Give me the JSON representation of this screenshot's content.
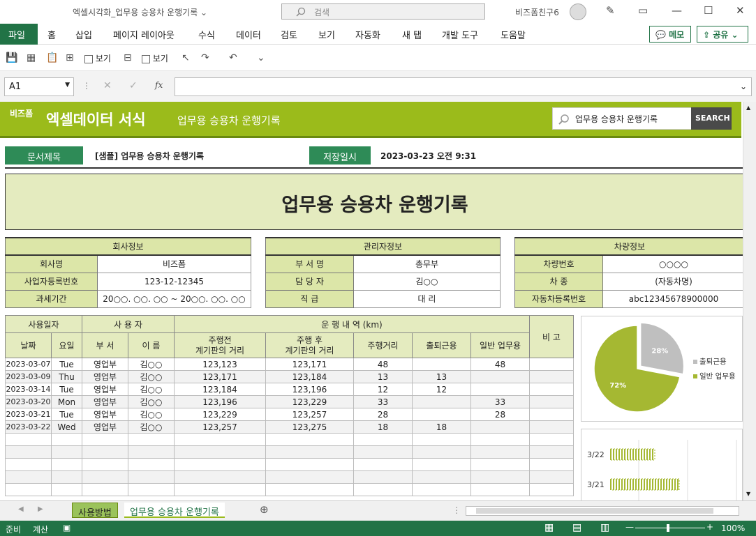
{
  "titlebar": {
    "doc_title": "엑셀시각화_업무용 승용차 운행기록 ⌄",
    "search": "검색",
    "user": "비즈폼친구6"
  },
  "ribbon": {
    "tabs": [
      "파일",
      "홈",
      "삽입",
      "페이지 레이아웃",
      "수식",
      "데이터",
      "검토",
      "보기",
      "자동화",
      "새 탭",
      "개발 도구",
      "도움말"
    ],
    "memo": "메모",
    "share": "공유"
  },
  "qat": {
    "view1": "보기",
    "view2": "보기"
  },
  "formula": {
    "namebox": "A1",
    "fx": "fx"
  },
  "banner": {
    "bz": "비즈폼",
    "brand": "엑셀데이터 서식",
    "sub": "업무용 승용차 운행기록",
    "search_value": "업무용 승용차 운행기록",
    "search_btn": "SEARCH"
  },
  "doc": {
    "title_label": "문서제목",
    "title_value": "[샘플] 업무용 승용차 운행기록",
    "date_label": "저장일시",
    "date_value": "2023-03-23   오전 9:31",
    "main_title": "업무용 승용차 운행기록"
  },
  "company": {
    "header": "회사정보",
    "rows": [
      [
        "회사명",
        "비즈폼"
      ],
      [
        "사업자등록번호",
        "123-12-12345"
      ],
      [
        "과세기간",
        "20○○. ○○. ○○ ~ 20○○. ○○. ○○"
      ]
    ]
  },
  "manager": {
    "header": "관리자정보",
    "rows": [
      [
        "부 서 명",
        "총무부"
      ],
      [
        "담 당 자",
        "김○○"
      ],
      [
        "직    급",
        "대  리"
      ]
    ]
  },
  "vehicle": {
    "header": "차량정보",
    "rows": [
      [
        "차량번호",
        "○○○○"
      ],
      [
        "차    종",
        "(자동차명)"
      ],
      [
        "자동차등록번호",
        "abc12345678900000"
      ]
    ]
  },
  "log": {
    "h_date": "사용일자",
    "h_user": "사 용 자",
    "h_run": "운 행 내 역 (km)",
    "h_note": "비 고",
    "c_date": "날짜",
    "c_day": "요일",
    "c_dept": "부 서",
    "c_name": "이  름",
    "c_before": "주행전\n계기판의 거리",
    "c_after": "주행 후\n계기판의 거리",
    "c_dist": "주행거리",
    "c_commute": "출퇴근용",
    "c_work": "일반 업무용",
    "rows": [
      [
        "2023-03-07",
        "Tue",
        "영업부",
        "김○○",
        "123,123",
        "123,171",
        "48",
        "",
        "48"
      ],
      [
        "2023-03-09",
        "Thu",
        "영업부",
        "김○○",
        "123,171",
        "123,184",
        "13",
        "13",
        ""
      ],
      [
        "2023-03-14",
        "Tue",
        "영업부",
        "김○○",
        "123,184",
        "123,196",
        "12",
        "12",
        ""
      ],
      [
        "2023-03-20",
        "Mon",
        "영업부",
        "김○○",
        "123,196",
        "123,229",
        "33",
        "",
        "33"
      ],
      [
        "2023-03-21",
        "Tue",
        "영업부",
        "김○○",
        "123,229",
        "123,257",
        "28",
        "",
        "28"
      ],
      [
        "2023-03-22",
        "Wed",
        "영업부",
        "김○○",
        "123,257",
        "123,275",
        "18",
        "18",
        ""
      ]
    ]
  },
  "chart_data": [
    {
      "type": "pie",
      "categories": [
        "출퇴근용",
        "일반 업무용"
      ],
      "values": [
        28,
        72
      ],
      "labels": [
        "28%",
        "72%"
      ],
      "colors": [
        "#bfbfbf",
        "#a5b832"
      ],
      "legend": "right"
    },
    {
      "type": "bar",
      "orientation": "horizontal",
      "categories": [
        "3/22",
        "3/21"
      ],
      "values": [
        18,
        28
      ],
      "colors": [
        "#a5b832"
      ]
    }
  ],
  "sheettabs": [
    "사용방법",
    "업무용 승용차 운행기록"
  ],
  "status": {
    "ready": "준비",
    "calc": "계산",
    "zoom": "100%"
  }
}
